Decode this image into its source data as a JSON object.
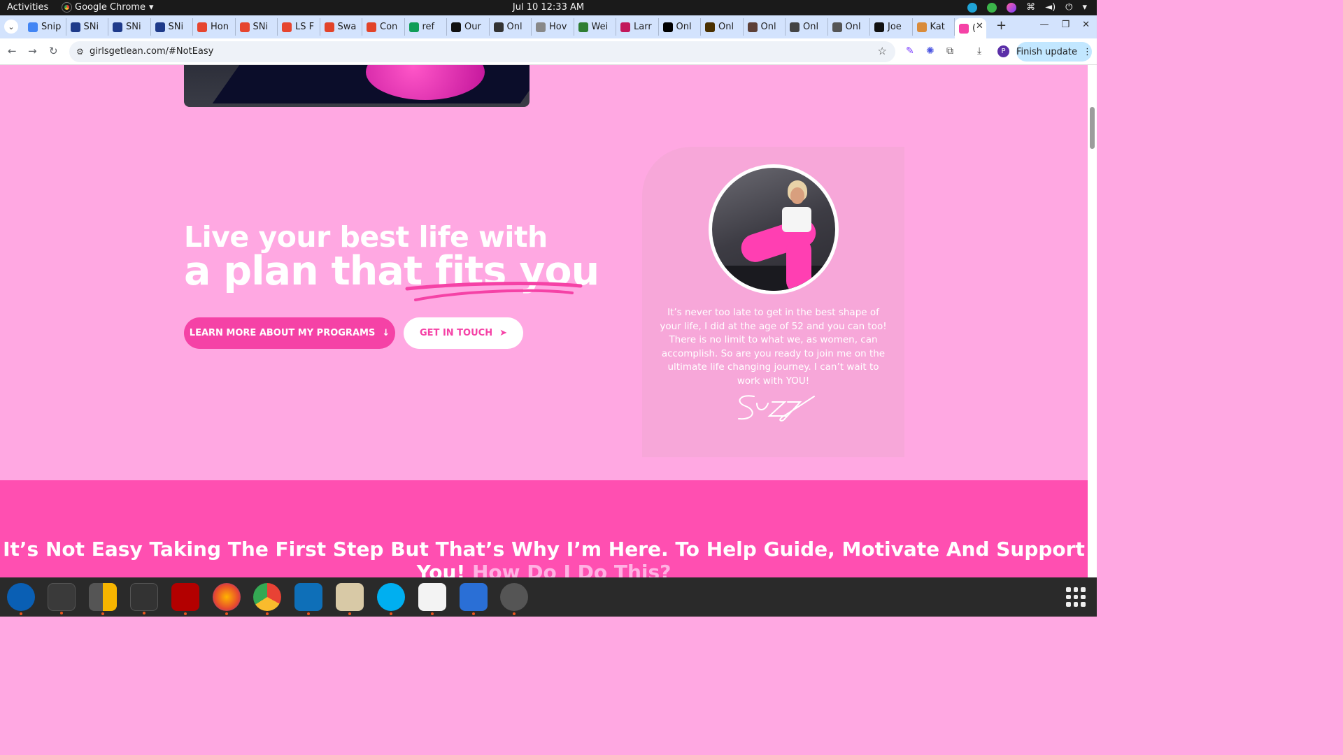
{
  "topbar": {
    "activities": "Activities",
    "app_name": "Google Chrome",
    "clock": "Jul 10  12:33 AM"
  },
  "tabs": [
    {
      "label": "Snip",
      "color": "#4285f4"
    },
    {
      "label": "SNi",
      "color": "#1e3a8a"
    },
    {
      "label": "SNi",
      "color": "#1e3a8a"
    },
    {
      "label": "SNi",
      "color": "#1e3a8a"
    },
    {
      "label": "Hon",
      "color": "#e6452f"
    },
    {
      "label": "SNi",
      "color": "#e6452f"
    },
    {
      "label": "LS F",
      "color": "#e6452f"
    },
    {
      "label": "Swa",
      "color": "#e24329"
    },
    {
      "label": "Con",
      "color": "#e24329"
    },
    {
      "label": "ref",
      "color": "#0f9d58"
    },
    {
      "label": "Our",
      "color": "#111111"
    },
    {
      "label": "Onl",
      "color": "#333333"
    },
    {
      "label": "Hov",
      "color": "#888888"
    },
    {
      "label": "Wei",
      "color": "#2e7d32"
    },
    {
      "label": "Larr",
      "color": "#c2185b"
    },
    {
      "label": "Onl",
      "color": "#000000"
    },
    {
      "label": "Onl",
      "color": "#4a3000"
    },
    {
      "label": "Onl",
      "color": "#5d4037"
    },
    {
      "label": "Onl",
      "color": "#444444"
    },
    {
      "label": "Onl",
      "color": "#555555"
    },
    {
      "label": "Joe",
      "color": "#111111"
    },
    {
      "label": "Kat",
      "color": "#d98b3a"
    }
  ],
  "active_tab": {
    "label": "(",
    "color": "#f542a6"
  },
  "navbar": {
    "url": "girlsgetlean.com/#NotEasy",
    "finish_update": "Finish update",
    "profile_letter": "P"
  },
  "hero": {
    "line1": "Live your best life with",
    "line2": "a plan that fits you",
    "btn_learn": "LEARN MORE ABOUT MY PROGRAMS",
    "btn_touch": "GET IN TOUCH"
  },
  "card": {
    "text": "It’s never too late to get in the best shape of your life, I did at the age of 52 and you can too! There is no limit to what we, as women, can accomplish. So are you ready to join me on the ultimate life changing journey. I can’t wait to work with YOU!",
    "signature": "Suzy"
  },
  "band": {
    "title": "It’s Not Easy Taking The First Step But That’s Why I’m Here. To Help Guide, Motivate And Support You!",
    "highlight": "How Do I Do This?"
  },
  "colors": {
    "page_bg": "#ffa8e2",
    "accent": "#f542a6",
    "band": "#ff4fb1"
  }
}
